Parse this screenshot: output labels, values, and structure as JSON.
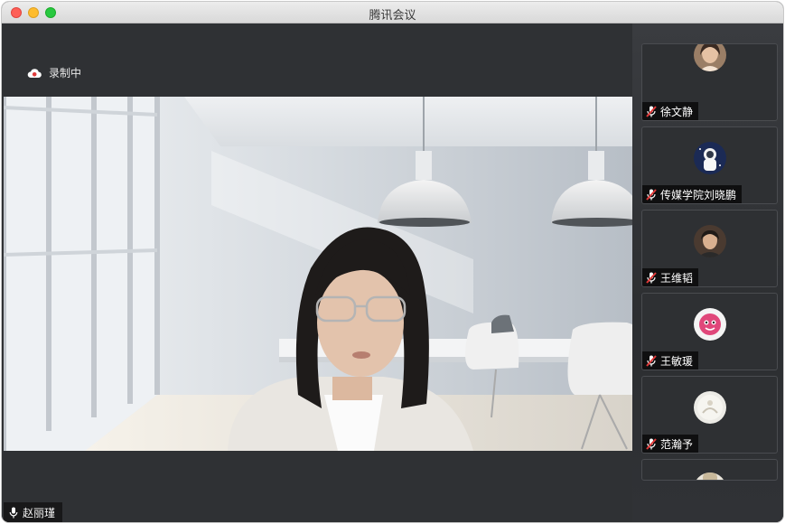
{
  "window": {
    "title": "腾讯会议"
  },
  "recording": {
    "label": "录制中",
    "icon": "cloud-record-icon",
    "color": "#e03b3b"
  },
  "main_speaker": {
    "name": "赵丽瑾",
    "mic_state": "on"
  },
  "participants": [
    {
      "name": "徐文静",
      "mic_state": "muted"
    },
    {
      "name": "传媒学院刘晓鹏",
      "mic_state": "muted"
    },
    {
      "name": "王维韬",
      "mic_state": "muted"
    },
    {
      "name": "王敏瑗",
      "mic_state": "muted"
    },
    {
      "name": "范瀚予",
      "mic_state": "muted"
    },
    {
      "name": "",
      "mic_state": "muted"
    }
  ],
  "colors": {
    "mic_muted": "#e23a3a",
    "background": "#2f3134"
  }
}
